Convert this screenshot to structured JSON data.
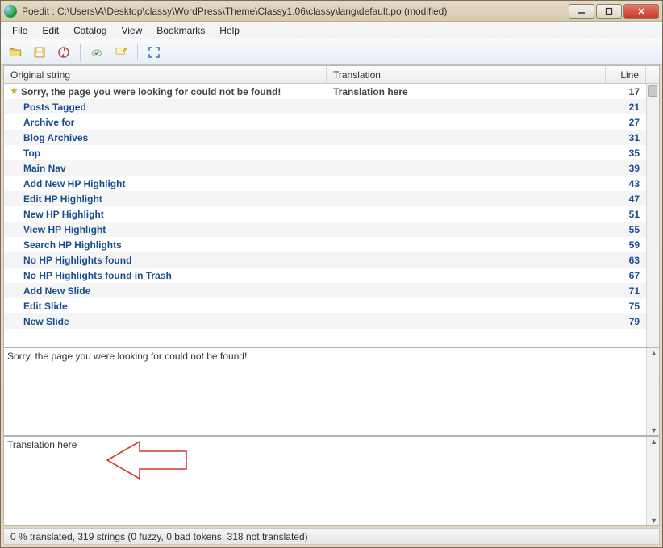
{
  "window": {
    "title": "Poedit : C:\\Users\\A\\Desktop\\classy\\WordPress\\Theme\\Classy1.06\\classy\\lang\\default.po (modified)"
  },
  "menu": {
    "file": "File",
    "edit": "Edit",
    "catalog": "Catalog",
    "view": "View",
    "bookmarks": "Bookmarks",
    "help": "Help"
  },
  "columns": {
    "original": "Original string",
    "translation": "Translation",
    "line": "Line"
  },
  "rows": [
    {
      "original": "Sorry, the page you were looking for could not be found!",
      "translation": "Translation here",
      "line": 17,
      "starred": true,
      "first": true
    },
    {
      "original": "Posts Tagged",
      "translation": "",
      "line": 21
    },
    {
      "original": "Archive for",
      "translation": "",
      "line": 27
    },
    {
      "original": "Blog Archives",
      "translation": "",
      "line": 31
    },
    {
      "original": "Top",
      "translation": "",
      "line": 35
    },
    {
      "original": "Main Nav",
      "translation": "",
      "line": 39
    },
    {
      "original": "Add New HP Highlight",
      "translation": "",
      "line": 43
    },
    {
      "original": "Edit HP Highlight",
      "translation": "",
      "line": 47
    },
    {
      "original": "New HP Highlight",
      "translation": "",
      "line": 51
    },
    {
      "original": "View HP Highlight",
      "translation": "",
      "line": 55
    },
    {
      "original": "Search HP Highlights",
      "translation": "",
      "line": 59
    },
    {
      "original": "No HP Highlights found",
      "translation": "",
      "line": 63
    },
    {
      "original": "No HP Highlights found in Trash",
      "translation": "",
      "line": 67
    },
    {
      "original": "Add New Slide",
      "translation": "",
      "line": 71
    },
    {
      "original": "Edit Slide",
      "translation": "",
      "line": 75
    },
    {
      "original": "New Slide",
      "translation": "",
      "line": 79
    }
  ],
  "source_pane": {
    "text": "Sorry, the page you were looking for could not be found!"
  },
  "translation_pane": {
    "text": "Translation here"
  },
  "status": {
    "text": "0 % translated, 319 strings (0 fuzzy, 0 bad tokens, 318 not translated)"
  },
  "icons": {
    "open": "open-folder-icon",
    "save": "save-icon",
    "sync": "sync-icon",
    "validate": "cloud-check-icon",
    "comment": "comment-edit-icon",
    "fullscreen": "fullscreen-icon"
  }
}
